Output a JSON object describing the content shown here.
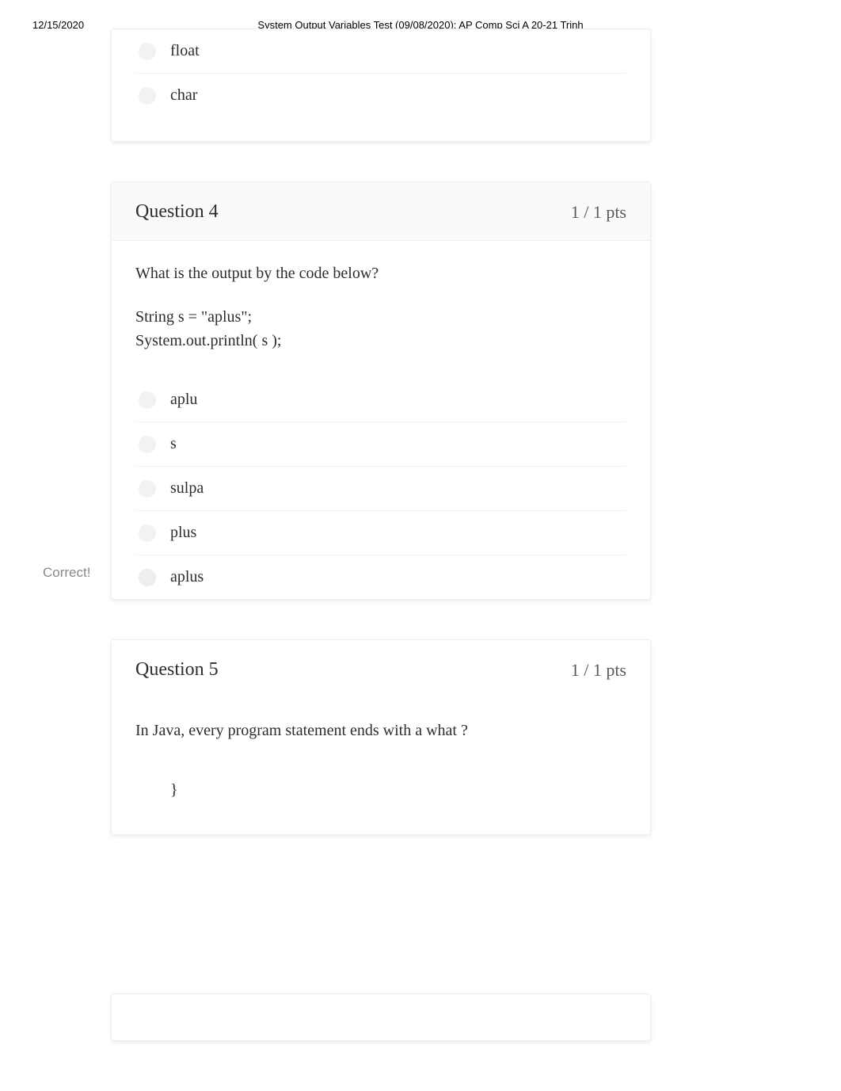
{
  "header": {
    "date": "12/15/2020",
    "title": "System Output Variables Test (09/08/2020): AP Comp Sci A 20-21 Trinh"
  },
  "partial_question_top": {
    "options": [
      {
        "label": "float"
      },
      {
        "label": "char"
      }
    ]
  },
  "question4": {
    "title": "Question 4",
    "points": "1 / 1 pts",
    "prompt": "What is the output by the code below?",
    "code": [
      "String s = \"aplus\";",
      "System.out.println( s );"
    ],
    "options": [
      {
        "label": "aplu",
        "correct": false
      },
      {
        "label": "s",
        "correct": false
      },
      {
        "label": "sulpa",
        "correct": false
      },
      {
        "label": "plus",
        "correct": false
      },
      {
        "label": "aplus",
        "correct": true
      }
    ],
    "correct_label": "Correct!"
  },
  "question5": {
    "title": "Question 5",
    "points": "1 / 1 pts",
    "prompt": "In Java, every program statement ends with a what ?",
    "options": [
      {
        "label": "}"
      }
    ]
  }
}
